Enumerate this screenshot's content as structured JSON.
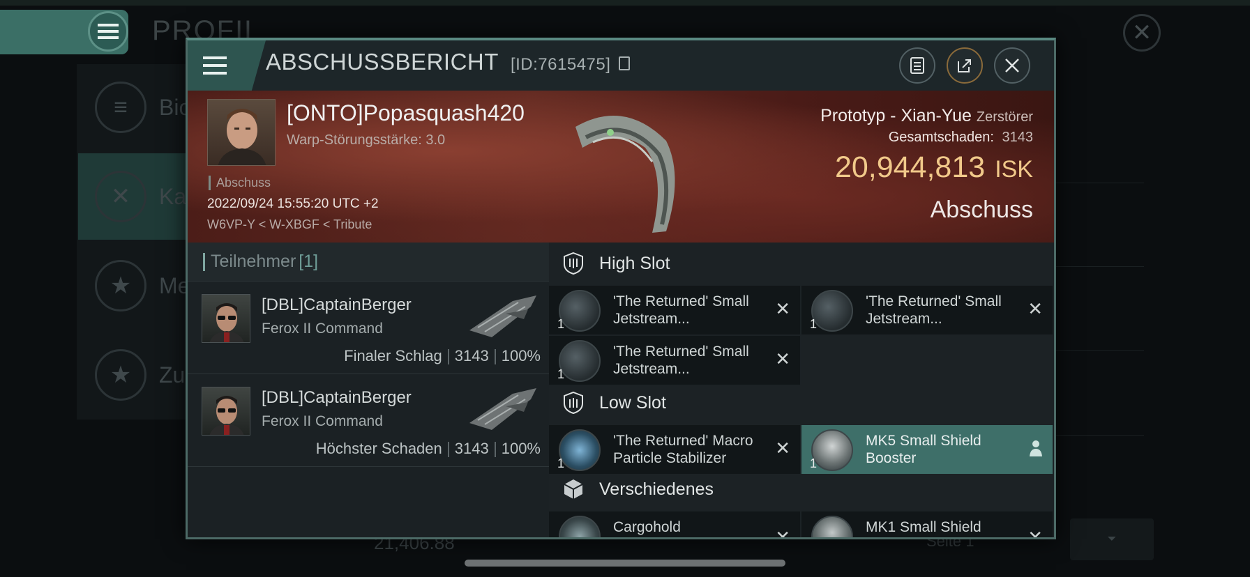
{
  "background": {
    "title": "PROFIL",
    "side_items": [
      {
        "label": "Bio"
      },
      {
        "label": "Ka"
      },
      {
        "label": "Me"
      },
      {
        "label": "Zu"
      }
    ],
    "isk": "21,406.88",
    "page": "Seite 1"
  },
  "dialog": {
    "title": "ABSCHUSSBERICHT",
    "id": "[ID:7615475]",
    "victim": {
      "name": "[ONTO]Popasquash420",
      "warp": "Warp-Störungsstärke: 3.0",
      "tag": "Abschuss",
      "datetime": "2022/09/24 15:55:20 UTC +2",
      "location": "W6VP-Y < W-XBGF < Tribute"
    },
    "ship": {
      "name": "Prototyp - Xian-Yue",
      "class": "Zerstörer",
      "damage_label": "Gesamtschaden:",
      "damage_value": "3143",
      "isk_value": "20,944,813",
      "isk_unit": "ISK",
      "kill_type": "Abschuss"
    },
    "participants": {
      "label": "Teilnehmer",
      "count": "[1]",
      "rows": [
        {
          "name": "[DBL]CaptainBerger",
          "ship": "Ferox II Command",
          "role": "Finaler Schlag",
          "damage": "3143",
          "percent": "100%"
        },
        {
          "name": "[DBL]CaptainBerger",
          "ship": "Ferox II Command",
          "role": "Höchster Schaden",
          "damage": "3143",
          "percent": "100%"
        }
      ]
    },
    "fitting": {
      "high_slot": {
        "label": "High Slot",
        "modules": [
          {
            "qty": "1",
            "name": "'The Returned' Small Jetstream..."
          },
          {
            "qty": "1",
            "name": "'The Returned' Small Jetstream..."
          },
          {
            "qty": "1",
            "name": "'The Returned' Small Jetstream..."
          }
        ]
      },
      "low_slot": {
        "label": "Low Slot",
        "modules": [
          {
            "qty": "1",
            "name": "'The Returned' Macro Particle Stabilizer"
          },
          {
            "qty": "1",
            "name": "MK5 Small Shield Booster"
          }
        ]
      },
      "misc": {
        "label": "Verschiedenes",
        "modules": [
          {
            "qty": "",
            "name": "Cargohold"
          },
          {
            "qty": "",
            "name": "MK1 Small Shield"
          }
        ]
      }
    }
  },
  "colors": {
    "accent": "#3e6f69",
    "isk": "#f1c98a",
    "banner": "#5e2820"
  }
}
